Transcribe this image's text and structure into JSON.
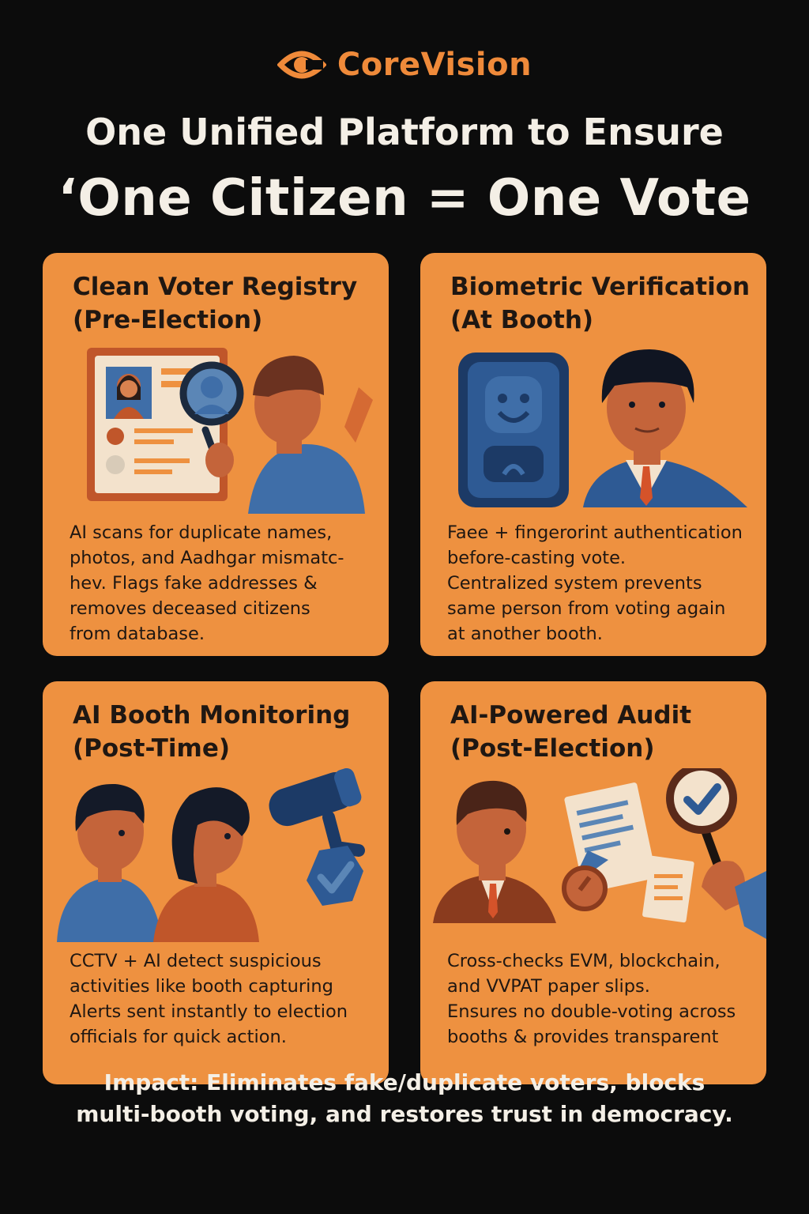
{
  "brand": {
    "name": "CoreVision",
    "logo_icon": "eye-icon",
    "color": "#ef8a3a"
  },
  "headline": {
    "line1": "One Unified Platform to Ensure",
    "line2": "‘One Citizen = One Vote"
  },
  "colors": {
    "background": "#0c0c0c",
    "card": "#ee9140",
    "accent_blue": "#3f6ea8",
    "text_light": "#f4efe6"
  },
  "cards": [
    {
      "title": [
        "Clean Voter Registry",
        "(Pre-Election)"
      ],
      "description": [
        "AI scans for duplicate names,",
        "photos, and Aadhgar mismatc-",
        "hev. Flags fake addresses &",
        "removes deceased citizens",
        "from database."
      ],
      "illustration": "voter-id-magnifier-icon"
    },
    {
      "title": [
        "Biometric Verification",
        "(At Booth)"
      ],
      "description": [
        "Faee + fingerorint authentication",
        "before-casting vote.",
        "Centralized system prevents",
        "same person from voting again",
        "at another booth."
      ],
      "illustration": "face-scanner-icon"
    },
    {
      "title": [
        "AI Booth Monitoring",
        "(Post-Time)"
      ],
      "description": [
        "CCTV + AI detect suspicious",
        "activities like booth capturing",
        "Alerts sent instantly to election",
        "officials for quick action."
      ],
      "illustration": "cctv-camera-icon"
    },
    {
      "title": [
        "AI-Powered Audit",
        "(Post-Election)"
      ],
      "description": [
        "Cross-checks EVM, blockchain,",
        "and VVPAT paper slips.",
        "Ensures no double-voting across",
        "booths & provides transparent"
      ],
      "illustration": "audit-magnifier-check-icon"
    }
  ],
  "impact": [
    "Impact: Eliminates fake/duplicate voters, blocks",
    "multi-booth voting, and restores trust in democracy."
  ]
}
